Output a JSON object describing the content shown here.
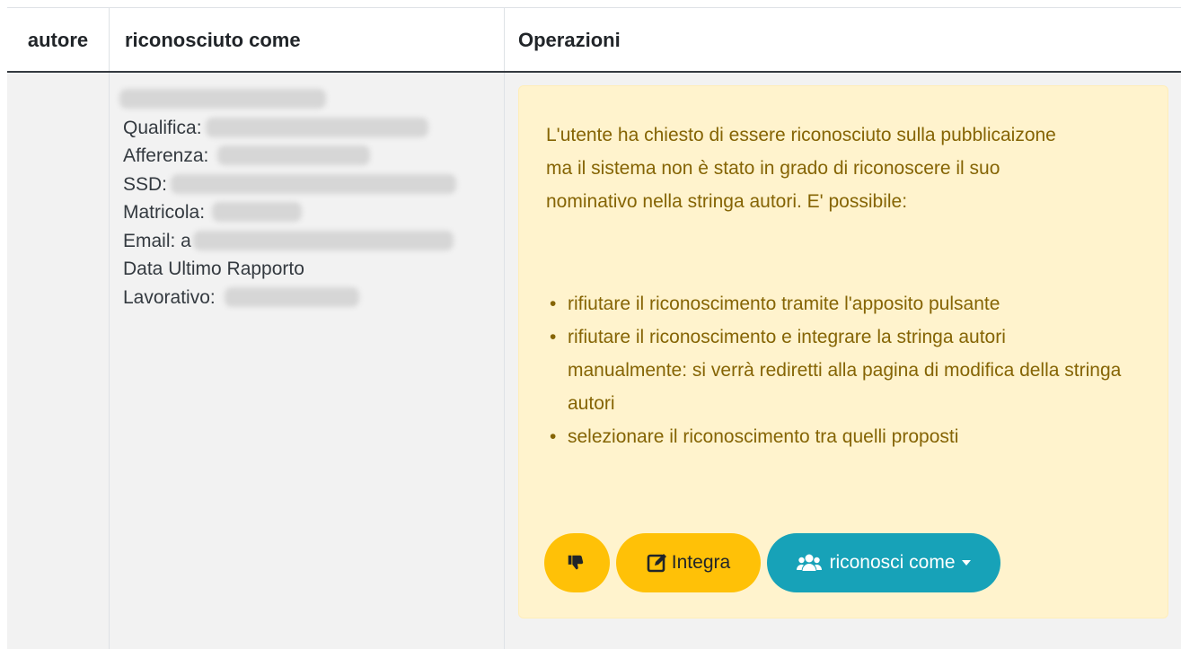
{
  "table": {
    "headers": {
      "author": "autore",
      "recognized_as": "riconosciuto come",
      "operations": "Operazioni"
    }
  },
  "person": {
    "qualifica_label": "Qualifica:",
    "afferenza_label": "Afferenza:",
    "ssd_label": "SSD:",
    "matricola_label": "Matricola:",
    "email_label": "Email: a",
    "data_label_line1": "Data Ultimo Rapporto",
    "data_label_line2": "Lavorativo:"
  },
  "alert": {
    "message": "L'utente ha chiesto di essere riconosciuto sulla pubblicaizone ma il sistema non è stato in grado di riconoscere il suo nominativo nella stringa autori. E' possibile:",
    "options": [
      "rifiutare il riconoscimento tramite l'apposito pulsante",
      "rifiutare il riconoscimento e integrare la stringa autori manualmente: si verrà rediretti alla pagina di modifica della stringa autori",
      "selezionare il riconoscimento tra quelli proposti"
    ]
  },
  "buttons": {
    "reject_icon": "thumbs-down-icon",
    "integrate_icon": "edit-icon",
    "integrate_label": "Integra",
    "recognize_icon": "users-icon",
    "recognize_label": "riconosci come"
  },
  "colors": {
    "warning": "#ffc107",
    "info": "#17a2b8",
    "alert_bg": "#fff3cd",
    "alert_text": "#856404"
  }
}
